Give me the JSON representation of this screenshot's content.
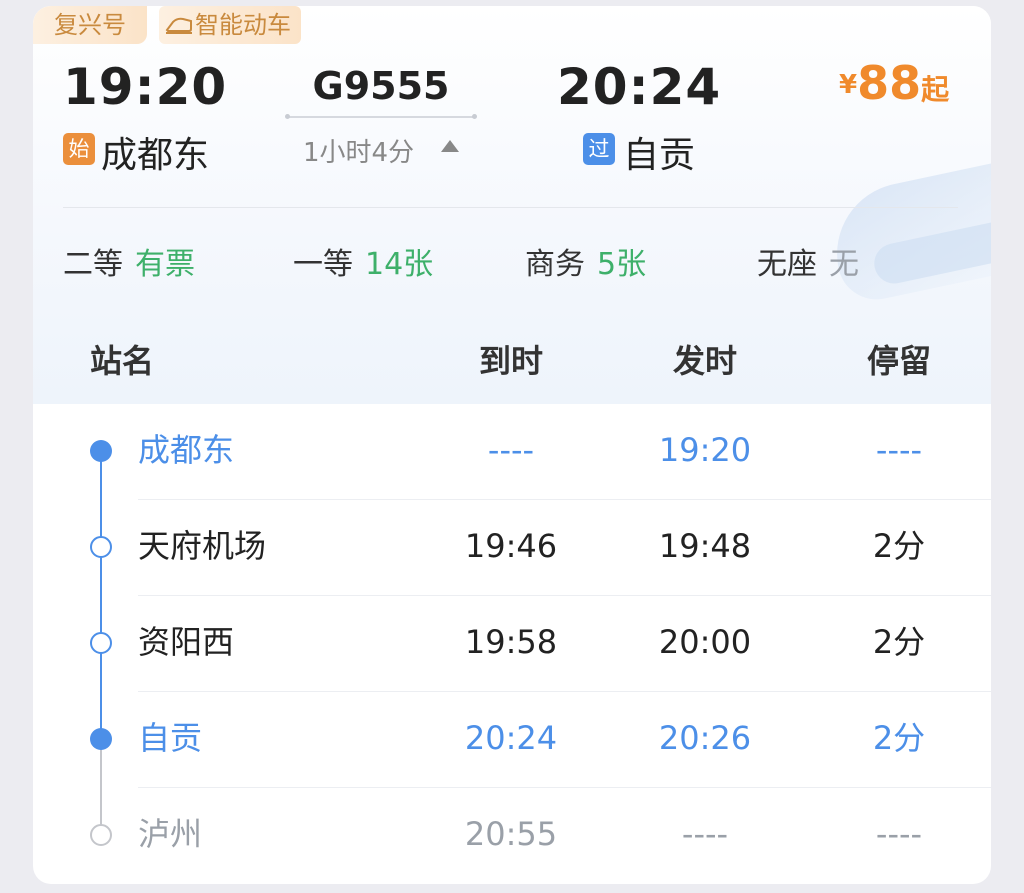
{
  "tags": {
    "train_brand": "复兴号",
    "smart_train": "智能动车",
    "smart_train_icon": "train-icon"
  },
  "header": {
    "departure_time": "19:20",
    "arrival_time": "20:24",
    "train_number": "G9555",
    "duration": "1小时4分",
    "duration_toggle_icon": "triangle-up-icon",
    "departure_badge": "始",
    "departure_station": "成都东",
    "arrival_badge": "过",
    "arrival_station": "自贡",
    "price_currency": "¥",
    "price_value": "88",
    "price_suffix": "起"
  },
  "seats": [
    {
      "class": "二等",
      "availability": "有票"
    },
    {
      "class": "一等",
      "availability": "14张"
    },
    {
      "class": "商务",
      "availability": "5张"
    },
    {
      "class": "无座",
      "availability": "无"
    }
  ],
  "table": {
    "headers": {
      "name": "站名",
      "arrive": "到时",
      "depart": "发时",
      "stop": "停留"
    },
    "rows": [
      {
        "name": "成都东",
        "arrive": "----",
        "depart": "19:20",
        "stop": "----"
      },
      {
        "name": "天府机场",
        "arrive": "19:46",
        "depart": "19:48",
        "stop": "2分"
      },
      {
        "name": "资阳西",
        "arrive": "19:58",
        "depart": "20:00",
        "stop": "2分"
      },
      {
        "name": "自贡",
        "arrive": "20:24",
        "depart": "20:26",
        "stop": "2分"
      },
      {
        "name": "泸州",
        "arrive": "20:55",
        "depart": "----",
        "stop": "----"
      }
    ]
  },
  "colors": {
    "accent_blue": "#4c8fe8",
    "available_green": "#3eb06a",
    "price_orange": "#f08a2c",
    "muted_gray": "#9aa0a8"
  }
}
